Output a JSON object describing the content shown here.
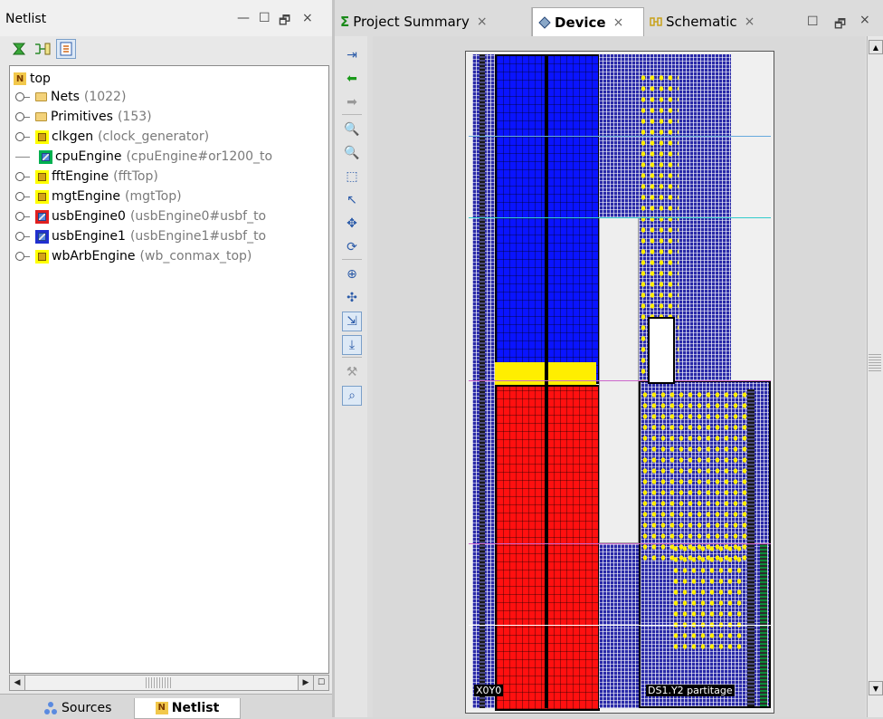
{
  "netlist_panel": {
    "title": "Netlist",
    "controls": {
      "minimize": "—",
      "maximize": "☐",
      "restore": "🗗",
      "close": "×"
    },
    "toolbar": [
      {
        "icon": "collapse-all-icon"
      },
      {
        "icon": "show-hierarchy-icon"
      },
      {
        "icon": "auto-select-icon",
        "active": true
      }
    ],
    "tree": {
      "root": "top",
      "items": [
        {
          "kind": "folder",
          "label": "Nets",
          "detail": "(1022)"
        },
        {
          "kind": "folder",
          "label": "Primitives",
          "detail": "(153)"
        },
        {
          "kind": "module",
          "label": "clkgen",
          "detail": "(clock_generator)",
          "color": "#ffff00",
          "expandable": true
        },
        {
          "kind": "module",
          "label": "cpuEngine",
          "detail": "(cpuEngine#or1200_to",
          "color": "#00b050",
          "expandable": false
        },
        {
          "kind": "module",
          "label": "fftEngine",
          "detail": "(fftTop)",
          "color": "#ffff00",
          "expandable": true
        },
        {
          "kind": "module",
          "label": "mgtEngine",
          "detail": "(mgtTop)",
          "color": "#ffff00",
          "expandable": true
        },
        {
          "kind": "module",
          "label": "usbEngine0",
          "detail": "(usbEngine0#usbf_to",
          "color": "#e02020",
          "expandable": true
        },
        {
          "kind": "module",
          "label": "usbEngine1",
          "detail": "(usbEngine1#usbf_to",
          "color": "#2030d0",
          "expandable": true
        },
        {
          "kind": "module",
          "label": "wbArbEngine",
          "detail": "(wb_conmax_top)",
          "color": "#ffff00",
          "expandable": true
        }
      ]
    },
    "bottom_tabs": [
      {
        "label": "Sources",
        "active": false
      },
      {
        "label": "Netlist",
        "active": true
      }
    ]
  },
  "editor": {
    "tabs": [
      {
        "label": "Project Summary",
        "icon": "sigma-icon",
        "active": false
      },
      {
        "label": "Device",
        "icon": "device-icon",
        "active": true
      },
      {
        "label": "Schematic",
        "icon": "schematic-icon",
        "active": false
      }
    ],
    "controls": {
      "maximize": "☐",
      "restore": "🗗",
      "close": "×"
    },
    "device_toolbar": [
      "fit-to-window-icon",
      "back-arrow-icon",
      "forward-arrow-icon",
      "zoom-in-icon",
      "zoom-out-icon",
      "zoom-area-icon",
      "select-icon",
      "autofit-selection-icon",
      "refresh-icon",
      "add-pblock-icon",
      "show-routing-icon",
      "route-tool-icon",
      "place-icon",
      "hammer-icon",
      "highlight-icon"
    ],
    "device_labels": {
      "left_bottom": "X0Y0",
      "right_bottom": "DS1.Y2 partitage"
    },
    "colors": {
      "blue_module": "#0a14ff",
      "red_module": "#ff1010",
      "yellow_module": "#ffee00"
    }
  }
}
